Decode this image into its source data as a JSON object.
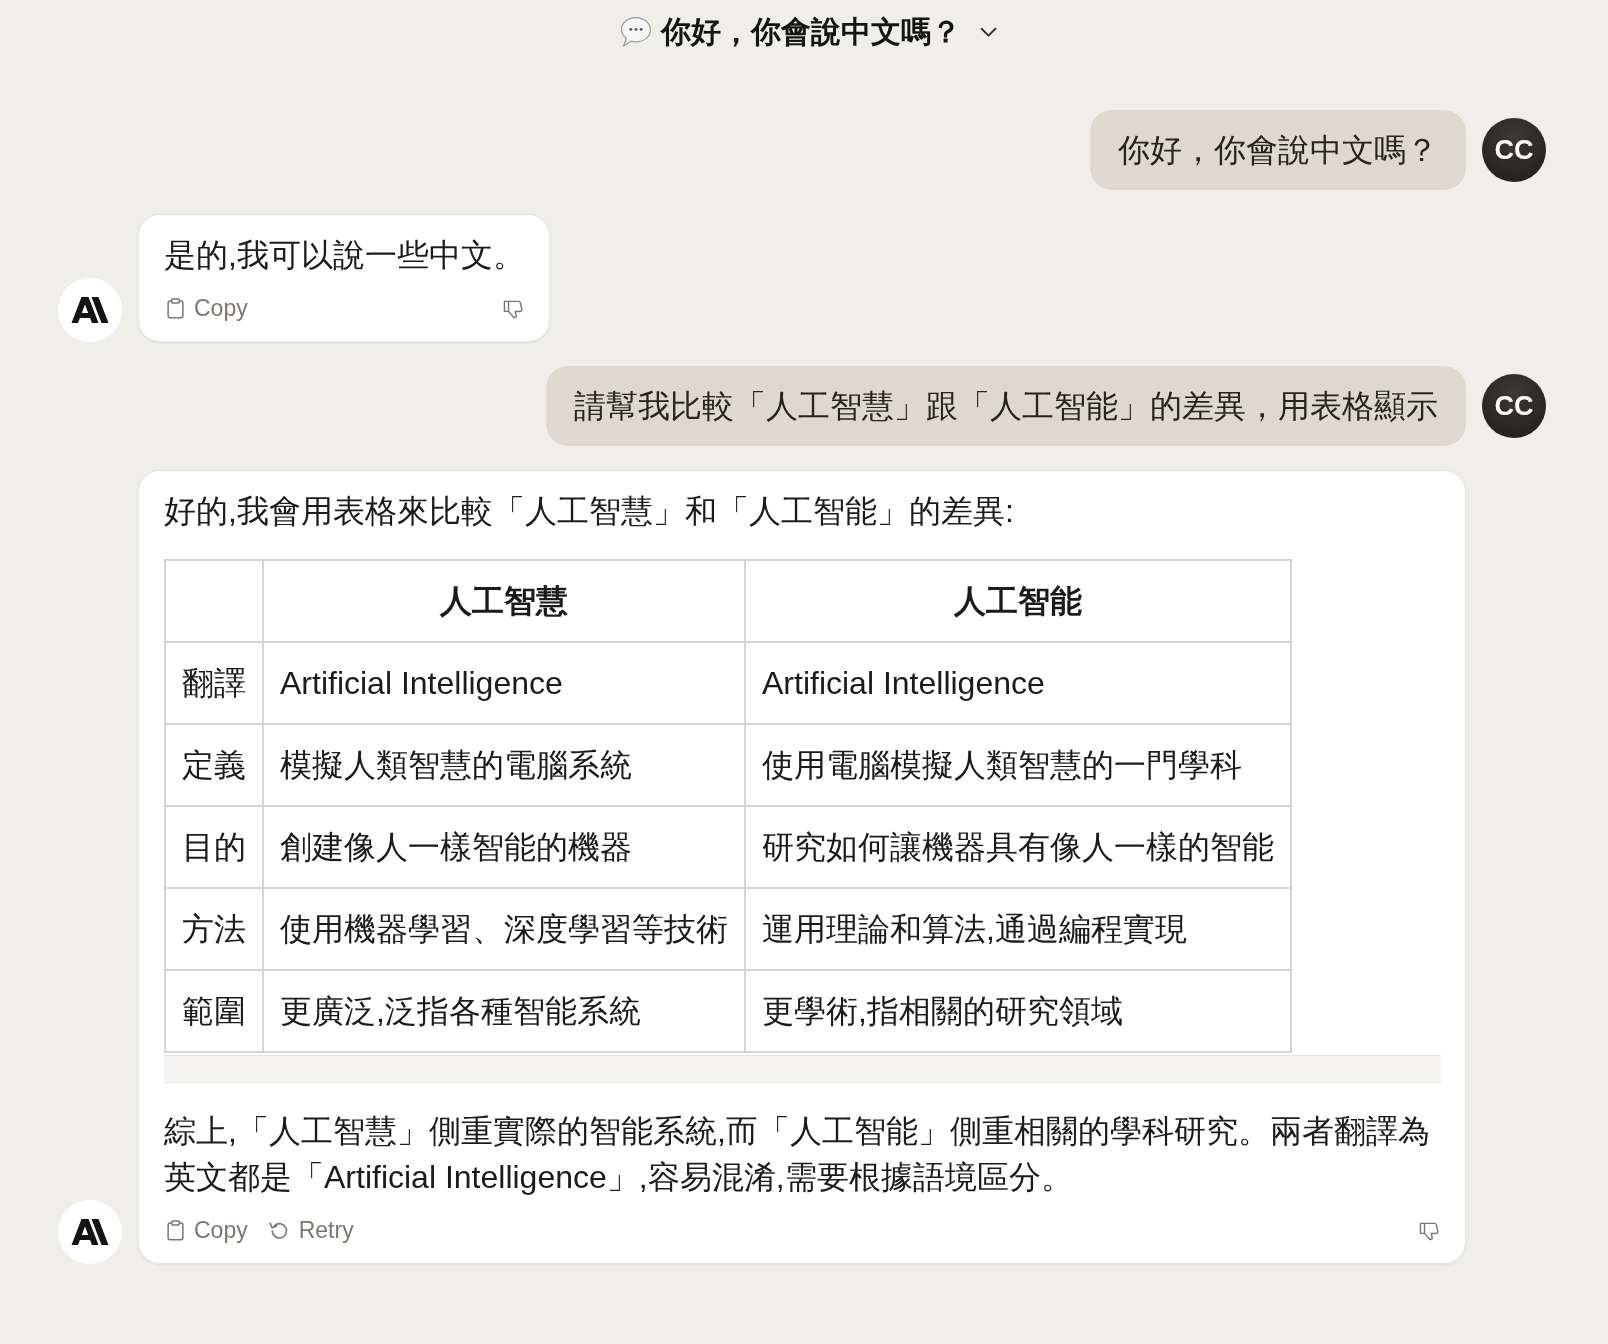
{
  "header": {
    "title": "你好，你會說中文嗎？"
  },
  "messages": [
    {
      "kind": "user",
      "avatar": "CC",
      "blocks": [
        {
          "kind": "paragraph",
          "text": "你好，你會說中文嗎？"
        }
      ]
    },
    {
      "kind": "assistant",
      "blocks": [
        {
          "kind": "paragraph",
          "text": "是的,我可以說一些中文。"
        }
      ],
      "actions": [
        {
          "kind": "copy",
          "label": "Copy"
        }
      ]
    },
    {
      "kind": "user",
      "avatar": "CC",
      "blocks": [
        {
          "kind": "paragraph",
          "text": "請幫我比較「人工智慧」跟「人工智能」的差異，用表格顯示"
        }
      ]
    },
    {
      "kind": "assistant",
      "blocks": [
        {
          "kind": "paragraph",
          "text": "好的,我會用表格來比較「人工智慧」和「人工智能」的差異:"
        },
        {
          "kind": "table",
          "columns": [
            "人工智慧",
            "人工智能"
          ],
          "rows": [
            {
              "label": "翻譯",
              "cells": [
                "Artificial Intelligence",
                "Artificial Intelligence"
              ]
            },
            {
              "label": "定義",
              "cells": [
                "模擬人類智慧的電腦系統",
                "使用電腦模擬人類智慧的一門學科"
              ]
            },
            {
              "label": "目的",
              "cells": [
                "創建像人一樣智能的機器",
                "研究如何讓機器具有像人一樣的智能"
              ]
            },
            {
              "label": "方法",
              "cells": [
                "使用機器學習、深度學習等技術",
                "運用理論和算法,通過編程實現"
              ]
            },
            {
              "label": "範圍",
              "cells": [
                "更廣泛,泛指各種智能系統",
                "更學術,指相關的研究領域"
              ]
            }
          ]
        },
        {
          "kind": "paragraph",
          "text": "綜上,「人工智慧」側重實際的智能系統,而「人工智能」側重相關的學科研究。兩者翻譯為英文都是「Artificial Intelligence」,容易混淆,需要根據語境區分。"
        }
      ],
      "actions": [
        {
          "kind": "copy",
          "label": "Copy"
        },
        {
          "kind": "retry",
          "label": "Retry"
        }
      ]
    }
  ]
}
